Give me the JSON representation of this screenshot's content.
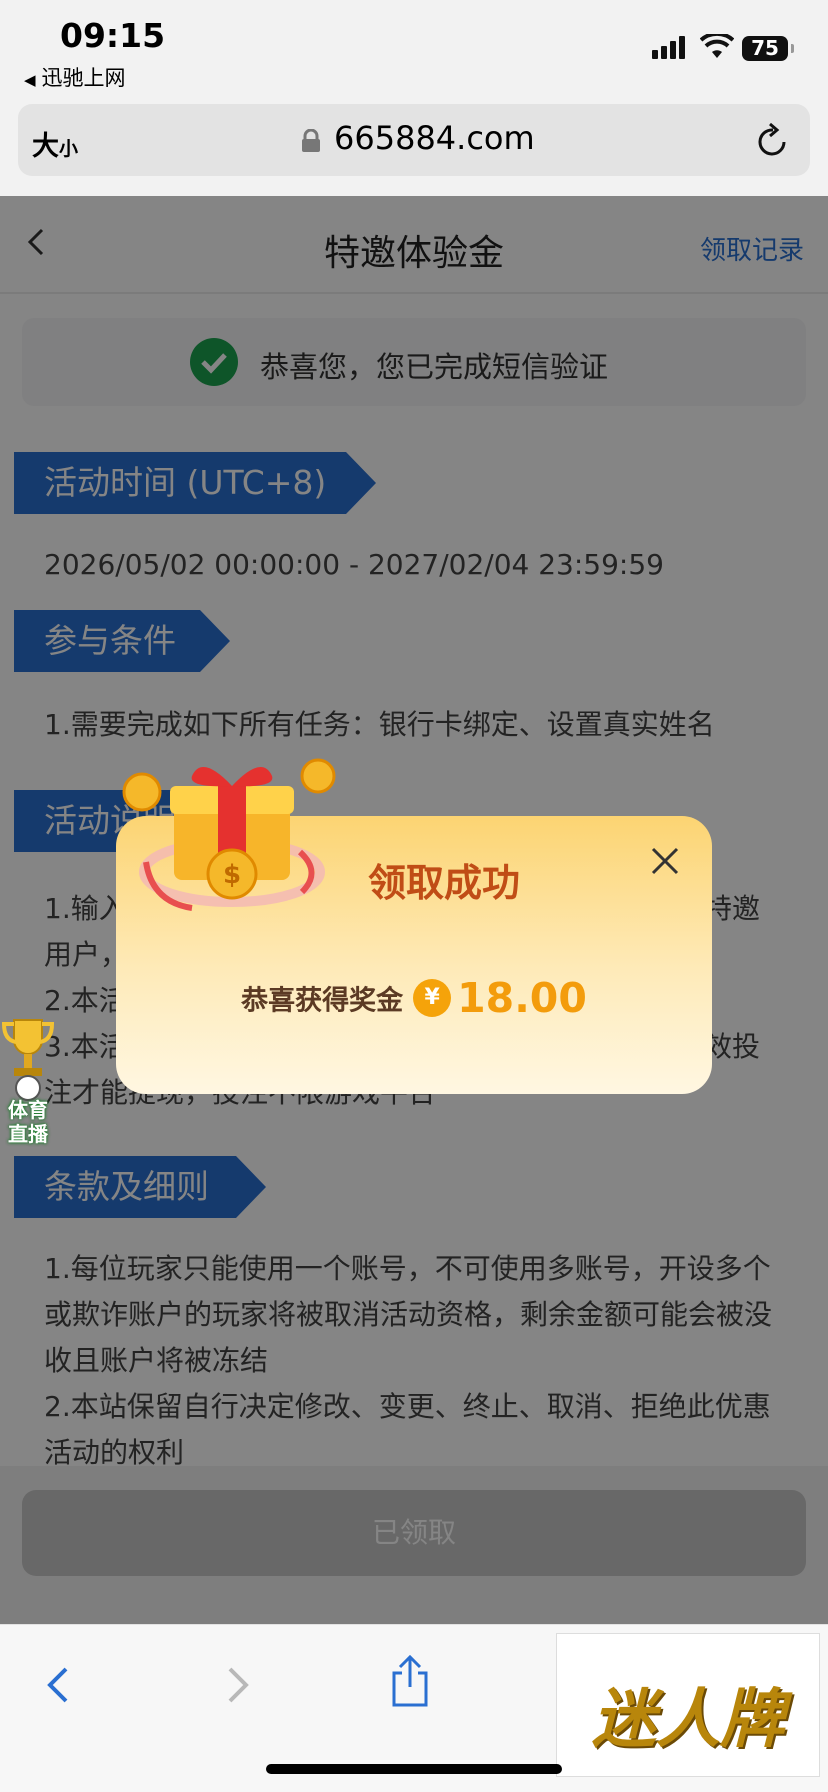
{
  "status_bar": {
    "time": "09:15",
    "back_app": "迅驰上网",
    "battery": "75"
  },
  "url_bar": {
    "text_size_big": "大",
    "text_size_small": "小",
    "url": "665884.com"
  },
  "nav": {
    "title": "特邀体验金",
    "records": "领取记录"
  },
  "verify": {
    "text": "恭喜您，您已完成短信验证"
  },
  "sections": {
    "time": {
      "title": "活动时间 (UTC+8)",
      "text": "2026/05/02 00:00:00 - 2027/02/04 23:59:59"
    },
    "conditions": {
      "title": "参与条件",
      "text": "1.需要完成如下所有任务：银行卡绑定、设置真实姓名"
    },
    "description": {
      "title": "活动说明",
      "lines": [
        "1.输入",
        "特邀",
        "用户，",
        "2.本活",
        "3.本活",
        "效投",
        "注才能提现，投注不限游戏平台"
      ]
    },
    "terms": {
      "title": "条款及细则",
      "text1": "1.每位玩家只能使用一个账号，不可使用多账号，开设多个或欺诈账户的玩家将被取消活动资格，剩余金额可能会被没收且账户将被冻结",
      "text2": "2.本站保留自行决定修改、变更、终止、取消、拒绝此优惠活动的权利"
    }
  },
  "claimed_button": "已领取",
  "modal": {
    "title": "领取成功",
    "reward_label": "恭喜获得奖金",
    "currency_symbol": "¥",
    "amount": "18.00"
  },
  "sport_badge": {
    "line1": "体育",
    "line2": "直播"
  },
  "ad": {
    "text": "迷人牌"
  },
  "colors": {
    "accent_blue": "#2a6fd1",
    "success_green": "#1ba34f",
    "reward_orange": "#f39c0c",
    "modal_title": "#c04d16"
  }
}
